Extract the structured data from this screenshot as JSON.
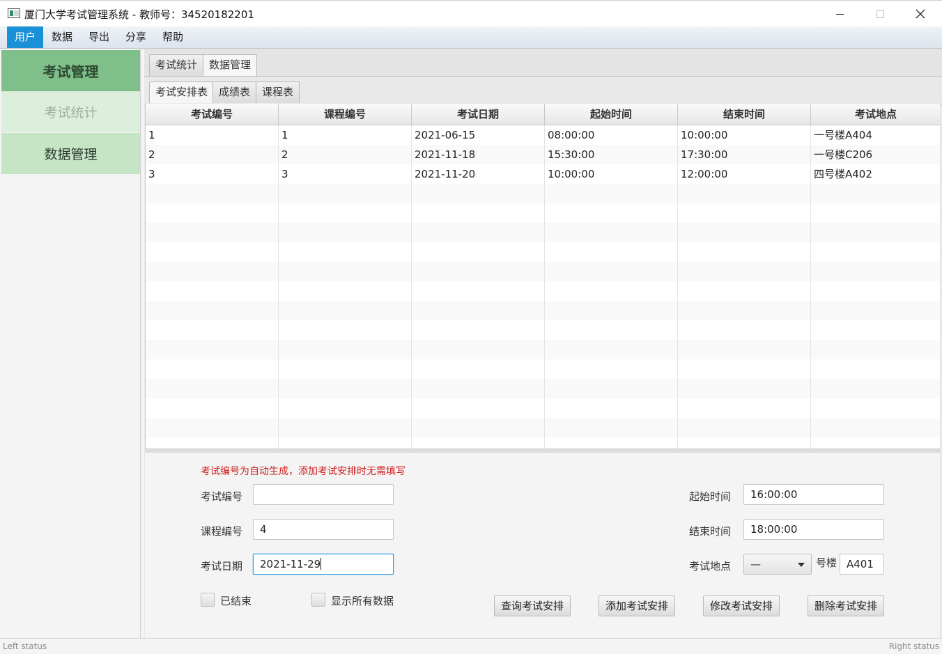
{
  "window": {
    "title": "厦门大学考试管理系统 - 教师号：34520182201"
  },
  "menu": {
    "items": [
      "用户",
      "数据",
      "导出",
      "分享",
      "帮助"
    ],
    "active": "用户"
  },
  "sidebar": {
    "header": "考试管理",
    "items": [
      {
        "label": "考试统计",
        "state": "dim"
      },
      {
        "label": "数据管理",
        "state": "selected"
      }
    ]
  },
  "tabs": {
    "top": [
      "考试统计",
      "数据管理"
    ],
    "top_active": "数据管理",
    "sub": [
      "考试安排表",
      "成绩表",
      "课程表"
    ],
    "sub_active": "考试安排表"
  },
  "table": {
    "columns": [
      "考试编号",
      "课程编号",
      "考试日期",
      "起始时间",
      "结束时间",
      "考试地点"
    ],
    "rows": [
      [
        "1",
        "1",
        "2021-06-15",
        "08:00:00",
        "10:00:00",
        "一号楼A404"
      ],
      [
        "2",
        "2",
        "2021-11-18",
        "15:30:00",
        "17:30:00",
        "一号楼C206"
      ],
      [
        "3",
        "3",
        "2021-11-20",
        "10:00:00",
        "12:00:00",
        "四号楼A402"
      ]
    ]
  },
  "form": {
    "hint": "考试编号为自动生成，添加考试安排时无需填写",
    "exam_id_label": "考试编号",
    "exam_id_value": "",
    "course_id_label": "课程编号",
    "course_id_value": "4",
    "exam_date_label": "考试日期",
    "exam_date_value": "2021-11-29",
    "start_time_label": "起始时间",
    "start_time_value": "16:00:00",
    "end_time_label": "结束时间",
    "end_time_value": "18:00:00",
    "location_label": "考试地点",
    "building_value": "—",
    "building_suffix": "号楼",
    "room_value": "A401",
    "finished_label": "已结束",
    "show_all_label": "显示所有数据",
    "buttons": {
      "query": "查询考试安排",
      "add": "添加考试安排",
      "modify": "修改考试安排",
      "delete": "删除考试安排"
    }
  },
  "status": {
    "left": "Left status",
    "right": "Right status"
  }
}
